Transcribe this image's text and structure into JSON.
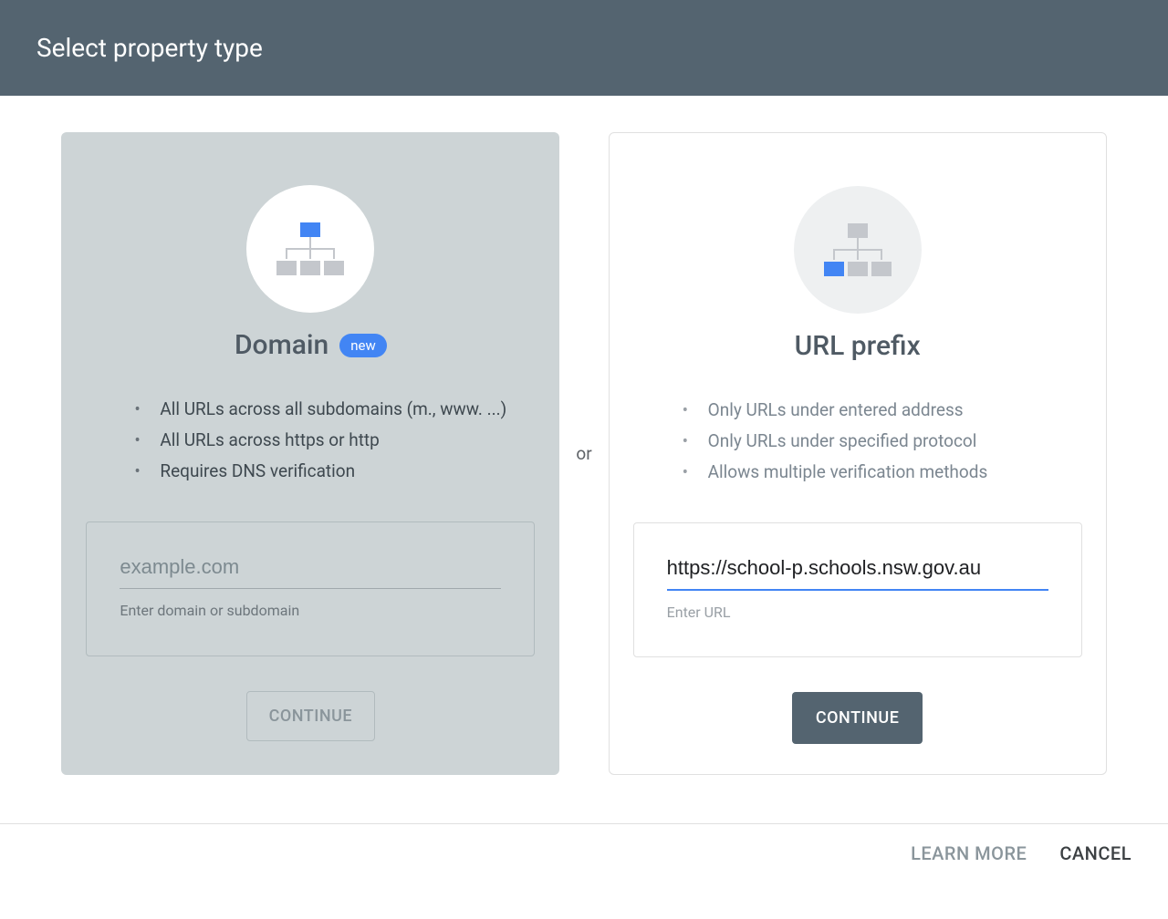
{
  "header": {
    "title": "Select property type"
  },
  "domain_card": {
    "title": "Domain",
    "badge": "new",
    "bullets": [
      "All URLs across all subdomains (m., www. ...)",
      "All URLs across https or http",
      "Requires DNS verification"
    ],
    "input_placeholder": "example.com",
    "input_value": "",
    "input_helper": "Enter domain or subdomain",
    "button_label": "CONTINUE"
  },
  "separator": "or",
  "url_card": {
    "title": "URL prefix",
    "bullets": [
      "Only URLs under entered address",
      "Only URLs under specified protocol",
      "Allows multiple verification methods"
    ],
    "input_value": "https://school-p.schools.nsw.gov.au",
    "input_helper": "Enter URL",
    "button_label": "CONTINUE"
  },
  "footer": {
    "learn_more": "LEARN MORE",
    "cancel": "CANCEL"
  },
  "colors": {
    "accent_blue": "#4285f4",
    "header_bg": "#546470",
    "gray_icon": "#c4c7cc"
  }
}
